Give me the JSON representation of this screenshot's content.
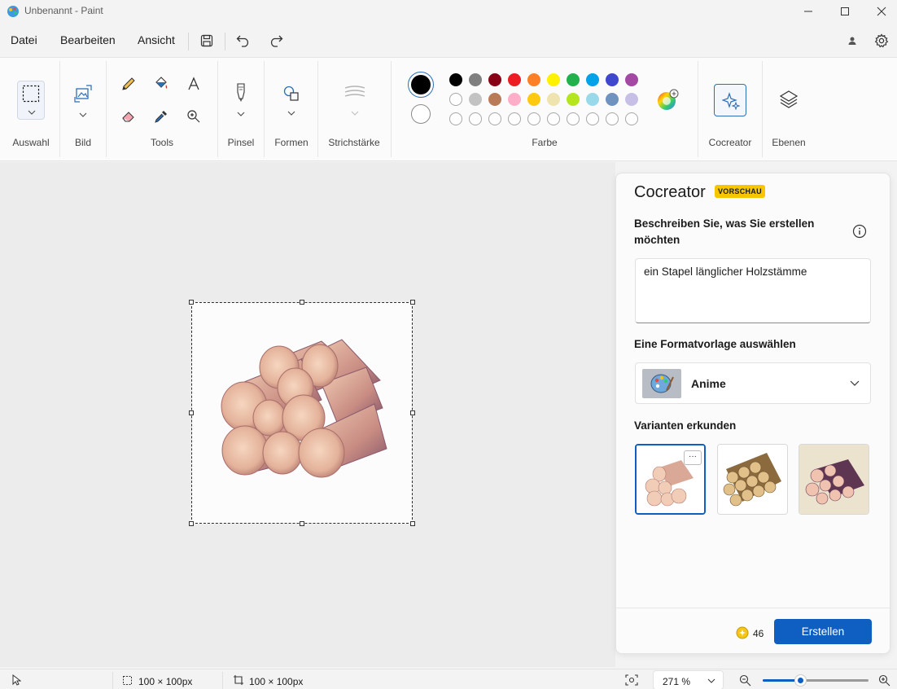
{
  "window": {
    "title": "Unbenannt - Paint"
  },
  "menu": {
    "items": [
      "Datei",
      "Bearbeiten",
      "Ansicht"
    ]
  },
  "ribbon": {
    "groups": {
      "selection": "Auswahl",
      "image": "Bild",
      "tools": "Tools",
      "brush": "Pinsel",
      "shapes": "Formen",
      "stroke": "Strichstärke",
      "color": "Farbe",
      "cocreator": "Cocreator",
      "layers": "Ebenen"
    },
    "colors": {
      "primary": "#000000",
      "secondary": "#ffffff",
      "row1": [
        "#000000",
        "#7f7f7f",
        "#880015",
        "#ed1c24",
        "#ff7f27",
        "#fff200",
        "#22b14c",
        "#00a2e8",
        "#3f48cc",
        "#a349a4"
      ],
      "row2": [
        "#ffffff",
        "#c3c3c3",
        "#b97a57",
        "#ffaec9",
        "#ffc90e",
        "#efe4b0",
        "#b5e61d",
        "#99d9ea",
        "#7092be",
        "#c8bfe7"
      ]
    }
  },
  "cocreator": {
    "title": "Cocreator",
    "badge": "VORSCHAU",
    "describe_label": "Beschreiben Sie, was Sie erstellen möchten",
    "prompt_value": "ein Stapel länglicher Holzstämme",
    "style_label": "Eine Formatvorlage auswählen",
    "style_value": "Anime",
    "variants_label": "Varianten erkunden",
    "more_label": "···",
    "credits": "46",
    "create_label": "Erstellen"
  },
  "status": {
    "selection_size": "100 × 100px",
    "canvas_size": "100 × 100px",
    "zoom": "271 %",
    "zoom_level_percent": 35
  }
}
